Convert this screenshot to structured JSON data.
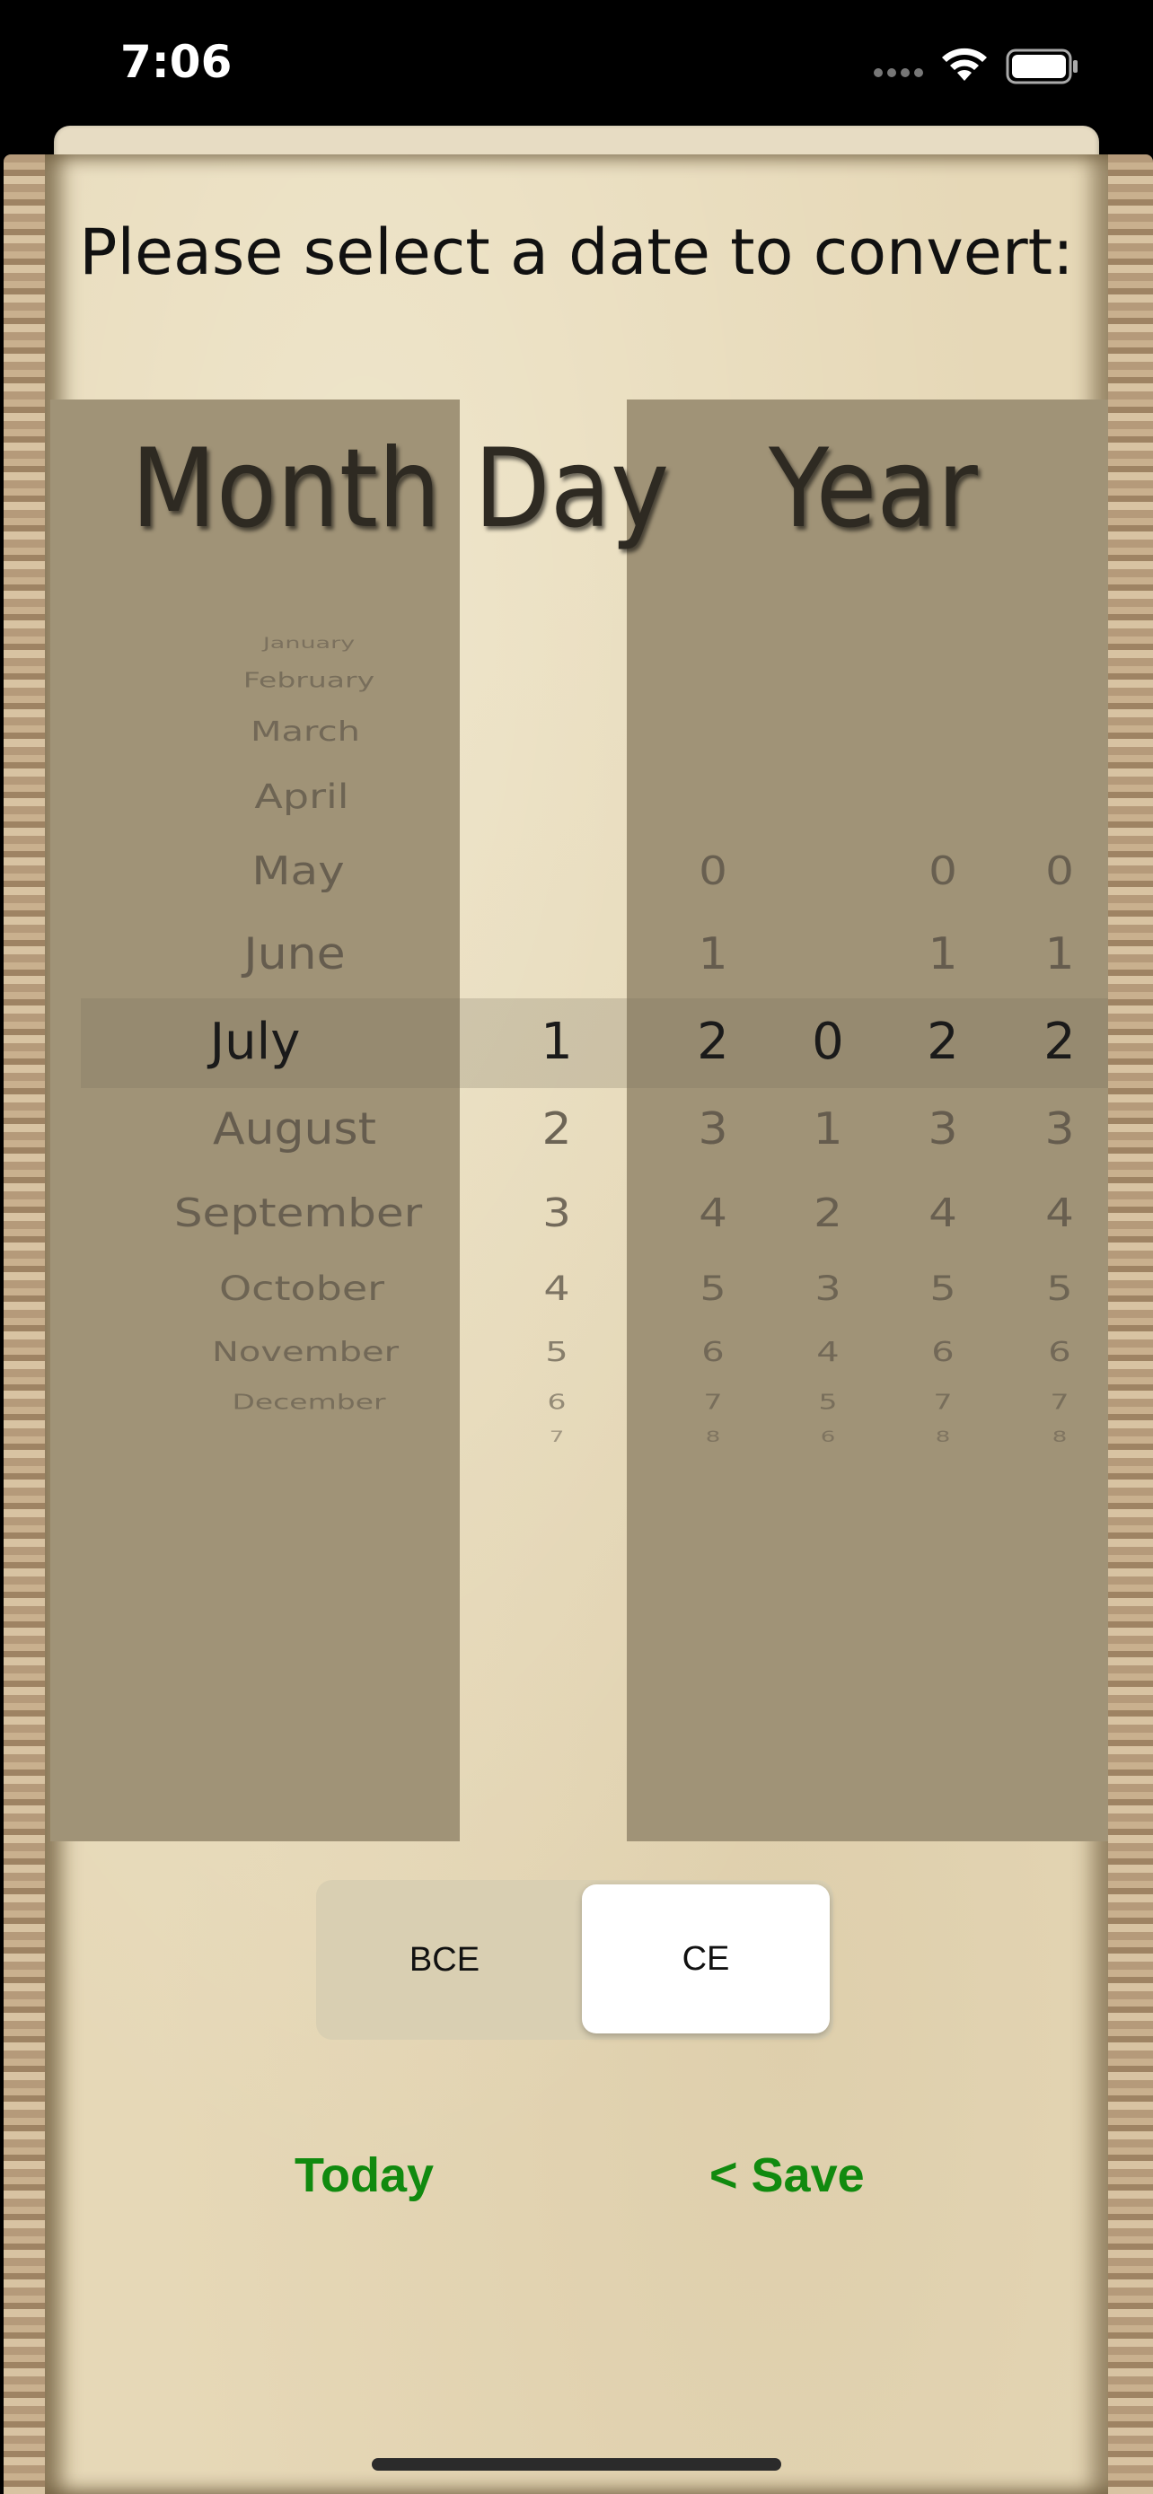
{
  "status_bar": {
    "time": "7:06",
    "icons": [
      "cellular-signal-icon",
      "wifi-icon",
      "battery-icon"
    ]
  },
  "prompt": "Please select a date to convert:",
  "picker": {
    "headers": {
      "month": "Month",
      "day": "Day",
      "year": "Year"
    },
    "months": [
      "January",
      "February",
      "March",
      "April",
      "May",
      "June",
      "July",
      "August",
      "September",
      "October",
      "November",
      "December"
    ],
    "selected_month": "July",
    "days": [
      "1",
      "2",
      "3",
      "4",
      "5",
      "6",
      "7"
    ],
    "selected_day": "1",
    "year_columns": [
      {
        "values": [
          "0",
          "1",
          "2",
          "3",
          "4",
          "5",
          "6",
          "7",
          "8"
        ],
        "selected": "2"
      },
      {
        "values": [
          "0",
          "1",
          "2",
          "3",
          "4",
          "5",
          "6"
        ],
        "selected": "0"
      },
      {
        "values": [
          "0",
          "1",
          "2",
          "3",
          "4",
          "5",
          "6",
          "7",
          "8"
        ],
        "selected": "2"
      },
      {
        "values": [
          "0",
          "1",
          "2",
          "3",
          "4",
          "5",
          "6",
          "7",
          "8"
        ],
        "selected": "2"
      }
    ]
  },
  "era": {
    "options": [
      "BCE",
      "CE"
    ],
    "selected": "CE"
  },
  "actions": {
    "today": "Today",
    "save": "< Save"
  },
  "colors": {
    "panel": "#a09377",
    "parchment": "#e6d8b7",
    "action": "#118a0f"
  }
}
